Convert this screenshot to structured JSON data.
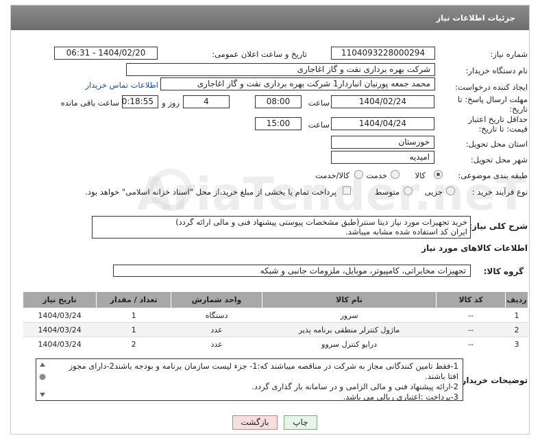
{
  "header": {
    "title": "جزئیات اطلاعات نیاز"
  },
  "labels": {
    "need_number": "شماره نیاز:",
    "public_date": "تاریخ و ساعت اعلان عمومی:",
    "buyer_name": "نام دستگاه خریدار:",
    "requester": "ایجاد کننده درخواست:",
    "reply_deadline": "مهلت ارسال پاسخ: تا تاریخ:",
    "min_validity": "حداقل تاریخ اعتبار قیمت: تا تاریخ:",
    "province": "استان محل تحویل:",
    "city": "شهر محل تحویل:",
    "category": "طبقه بندی موضوعی:",
    "process_type": "نوع فرآیند خرید :",
    "hour": "ساعت",
    "day_and": "روز و",
    "hours_left": "ساعت باقی مانده",
    "desc": "شرح کلی نیاز:",
    "goods_info": "اطلاعات کالاهای مورد نیاز",
    "goods_group": "گروه کالا:",
    "buyer_notes": "توضیحات خریدار:"
  },
  "fields": {
    "need_number": "1104093228000294",
    "public_date": "1404/02/20 - 06:31",
    "buyer_name": "شرکت بهره برداری نفت و گاز اغاجاری",
    "requester": "محمد جمعه پورنیان انباردار1 شرکت بهره برداری نفت و گاز اغاجاری",
    "contact_link": "اطلاعات تماس خریدار",
    "reply_date": "1404/02/24",
    "reply_time": "08:00",
    "days": "4",
    "remaining": "00:18:55",
    "validity_date": "1404/04/24",
    "validity_time": "15:00",
    "province": "خوزستان",
    "city": "امیدیه"
  },
  "category_options": [
    {
      "label": "کالا",
      "selected": true
    },
    {
      "label": "خدمت",
      "selected": false
    },
    {
      "label": "کالا/خدمت",
      "selected": false
    }
  ],
  "process_options": [
    {
      "label": "جزیی",
      "selected": false
    },
    {
      "label": "متوسط",
      "selected": false
    }
  ],
  "payment_note": "پرداخت تمام یا بخشی از مبلغ خرید،از محل \"اسناد خزانه اسلامی\" خواهد بود.",
  "description": {
    "line1": "خرید تجهیزات مورد نیاز دیتا سنتر(طبق مشخصات پیوستی پیشنهاد فنی و مالی ارائه گردد)",
    "line2": "ایران کد استفاده شده مشابه میباشد."
  },
  "goods_group": "تجهیزات مخابراتی، کامپیوتر، موبایل، ملزومات جانبی و شبکه",
  "table": {
    "headers": [
      "ردیف",
      "کد کالا",
      "نام کالا",
      "واحد شمارش",
      "تعداد / مقدار",
      "تاریخ نیاز"
    ],
    "rows": [
      [
        "1",
        "--",
        "سرور",
        "دستگاه",
        "1",
        "1404/03/24"
      ],
      [
        "2",
        "--",
        "ماژول کنترلر منطقی برنامه پذیر",
        "عدد",
        "1",
        "1404/03/24"
      ],
      [
        "3",
        "--",
        "درایو کنترل سروو",
        "عدد",
        "2",
        "1404/03/24"
      ]
    ]
  },
  "notes": [
    "1-فقط تامین کنندگانی مجاز به شرکت در مناقصه میباشند که:1- جزء لیست سازمان برنامه و بودجه باشند2-دارای مجوز",
    "افتا باشند.",
    "2-ارائه پیشنهاد فنی و مالی الزامی و در سامانه بار گذاری گردد.",
    "3-پرداخت :اعتباری ریالی  می باشد."
  ],
  "buttons": {
    "print": "چاپ",
    "back": "بازگشت"
  },
  "watermark": "AriaTender.neT",
  "colors": {
    "header_bg": "#7a7a7a",
    "table_header": "#a8a8a8",
    "print_btn": "#e6f5e6",
    "back_btn": "#f9dede"
  }
}
